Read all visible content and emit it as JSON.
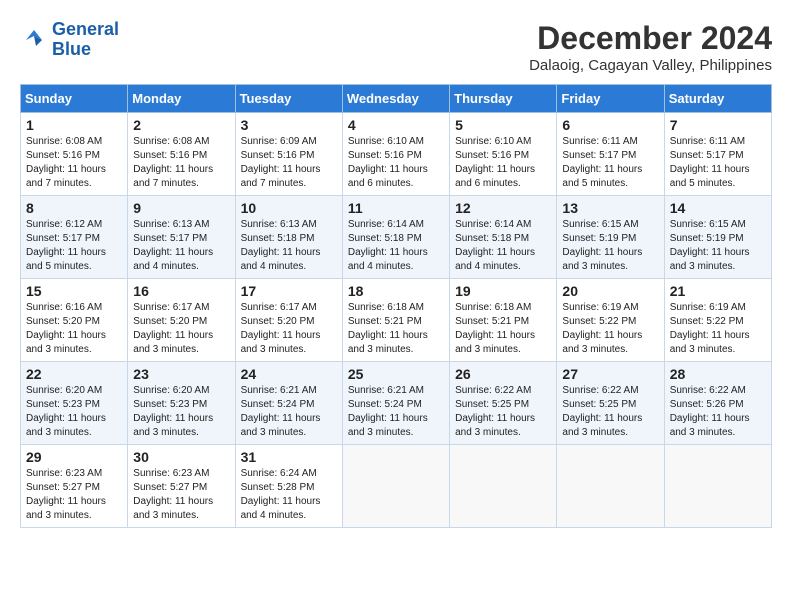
{
  "header": {
    "logo_line1": "General",
    "logo_line2": "Blue",
    "month_title": "December 2024",
    "location": "Dalaoig, Cagayan Valley, Philippines"
  },
  "days_of_week": [
    "Sunday",
    "Monday",
    "Tuesday",
    "Wednesday",
    "Thursday",
    "Friday",
    "Saturday"
  ],
  "weeks": [
    [
      {
        "day": "1",
        "info": "Sunrise: 6:08 AM\nSunset: 5:16 PM\nDaylight: 11 hours and 7 minutes."
      },
      {
        "day": "2",
        "info": "Sunrise: 6:08 AM\nSunset: 5:16 PM\nDaylight: 11 hours and 7 minutes."
      },
      {
        "day": "3",
        "info": "Sunrise: 6:09 AM\nSunset: 5:16 PM\nDaylight: 11 hours and 7 minutes."
      },
      {
        "day": "4",
        "info": "Sunrise: 6:10 AM\nSunset: 5:16 PM\nDaylight: 11 hours and 6 minutes."
      },
      {
        "day": "5",
        "info": "Sunrise: 6:10 AM\nSunset: 5:16 PM\nDaylight: 11 hours and 6 minutes."
      },
      {
        "day": "6",
        "info": "Sunrise: 6:11 AM\nSunset: 5:17 PM\nDaylight: 11 hours and 5 minutes."
      },
      {
        "day": "7",
        "info": "Sunrise: 6:11 AM\nSunset: 5:17 PM\nDaylight: 11 hours and 5 minutes."
      }
    ],
    [
      {
        "day": "8",
        "info": "Sunrise: 6:12 AM\nSunset: 5:17 PM\nDaylight: 11 hours and 5 minutes."
      },
      {
        "day": "9",
        "info": "Sunrise: 6:13 AM\nSunset: 5:17 PM\nDaylight: 11 hours and 4 minutes."
      },
      {
        "day": "10",
        "info": "Sunrise: 6:13 AM\nSunset: 5:18 PM\nDaylight: 11 hours and 4 minutes."
      },
      {
        "day": "11",
        "info": "Sunrise: 6:14 AM\nSunset: 5:18 PM\nDaylight: 11 hours and 4 minutes."
      },
      {
        "day": "12",
        "info": "Sunrise: 6:14 AM\nSunset: 5:18 PM\nDaylight: 11 hours and 4 minutes."
      },
      {
        "day": "13",
        "info": "Sunrise: 6:15 AM\nSunset: 5:19 PM\nDaylight: 11 hours and 3 minutes."
      },
      {
        "day": "14",
        "info": "Sunrise: 6:15 AM\nSunset: 5:19 PM\nDaylight: 11 hours and 3 minutes."
      }
    ],
    [
      {
        "day": "15",
        "info": "Sunrise: 6:16 AM\nSunset: 5:20 PM\nDaylight: 11 hours and 3 minutes."
      },
      {
        "day": "16",
        "info": "Sunrise: 6:17 AM\nSunset: 5:20 PM\nDaylight: 11 hours and 3 minutes."
      },
      {
        "day": "17",
        "info": "Sunrise: 6:17 AM\nSunset: 5:20 PM\nDaylight: 11 hours and 3 minutes."
      },
      {
        "day": "18",
        "info": "Sunrise: 6:18 AM\nSunset: 5:21 PM\nDaylight: 11 hours and 3 minutes."
      },
      {
        "day": "19",
        "info": "Sunrise: 6:18 AM\nSunset: 5:21 PM\nDaylight: 11 hours and 3 minutes."
      },
      {
        "day": "20",
        "info": "Sunrise: 6:19 AM\nSunset: 5:22 PM\nDaylight: 11 hours and 3 minutes."
      },
      {
        "day": "21",
        "info": "Sunrise: 6:19 AM\nSunset: 5:22 PM\nDaylight: 11 hours and 3 minutes."
      }
    ],
    [
      {
        "day": "22",
        "info": "Sunrise: 6:20 AM\nSunset: 5:23 PM\nDaylight: 11 hours and 3 minutes."
      },
      {
        "day": "23",
        "info": "Sunrise: 6:20 AM\nSunset: 5:23 PM\nDaylight: 11 hours and 3 minutes."
      },
      {
        "day": "24",
        "info": "Sunrise: 6:21 AM\nSunset: 5:24 PM\nDaylight: 11 hours and 3 minutes."
      },
      {
        "day": "25",
        "info": "Sunrise: 6:21 AM\nSunset: 5:24 PM\nDaylight: 11 hours and 3 minutes."
      },
      {
        "day": "26",
        "info": "Sunrise: 6:22 AM\nSunset: 5:25 PM\nDaylight: 11 hours and 3 minutes."
      },
      {
        "day": "27",
        "info": "Sunrise: 6:22 AM\nSunset: 5:25 PM\nDaylight: 11 hours and 3 minutes."
      },
      {
        "day": "28",
        "info": "Sunrise: 6:22 AM\nSunset: 5:26 PM\nDaylight: 11 hours and 3 minutes."
      }
    ],
    [
      {
        "day": "29",
        "info": "Sunrise: 6:23 AM\nSunset: 5:27 PM\nDaylight: 11 hours and 3 minutes."
      },
      {
        "day": "30",
        "info": "Sunrise: 6:23 AM\nSunset: 5:27 PM\nDaylight: 11 hours and 3 minutes."
      },
      {
        "day": "31",
        "info": "Sunrise: 6:24 AM\nSunset: 5:28 PM\nDaylight: 11 hours and 4 minutes."
      },
      {
        "day": "",
        "info": ""
      },
      {
        "day": "",
        "info": ""
      },
      {
        "day": "",
        "info": ""
      },
      {
        "day": "",
        "info": ""
      }
    ]
  ]
}
